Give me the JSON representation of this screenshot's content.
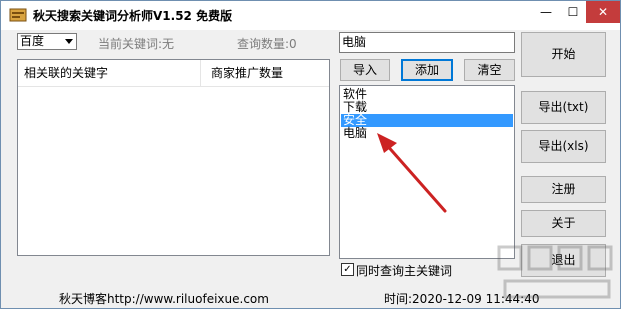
{
  "window": {
    "title": "秋天搜索关键词分析师V1.52 免费版",
    "buttons": {
      "minimize": "—",
      "maximize": "☐",
      "close": "✕"
    }
  },
  "engine_select": {
    "value": "百度"
  },
  "status": {
    "current_keyword": "当前关键词:无",
    "query_count": "查询数量:0"
  },
  "results_table": {
    "columns": [
      "相关联的关键字",
      "商家推广数量"
    ]
  },
  "keyword_input": {
    "value": "电脑"
  },
  "keyword_actions": {
    "import": "导入",
    "add": "添加",
    "clear": "清空"
  },
  "keyword_list": {
    "items": [
      "软件",
      "下载",
      "安全",
      "电脑"
    ],
    "selected": "安全"
  },
  "checkbox": {
    "label": "同时查询主关键词",
    "checked": true
  },
  "right_buttons": {
    "start": "开始",
    "export_txt": "导出(txt)",
    "export_xls": "导出(xls)",
    "register": "注册",
    "about": "关于",
    "exit": "退出"
  },
  "footer": {
    "blog": "秋天博客http://www.riluofeixue.com",
    "time": "时间:2020-12-09 11:44:40"
  },
  "colors": {
    "window_bg": "#f0f0f0",
    "selection": "#3399ff",
    "focus_border": "#0078d7",
    "annotation_arrow": "#cc2222",
    "close_button": "#c43c3c"
  }
}
